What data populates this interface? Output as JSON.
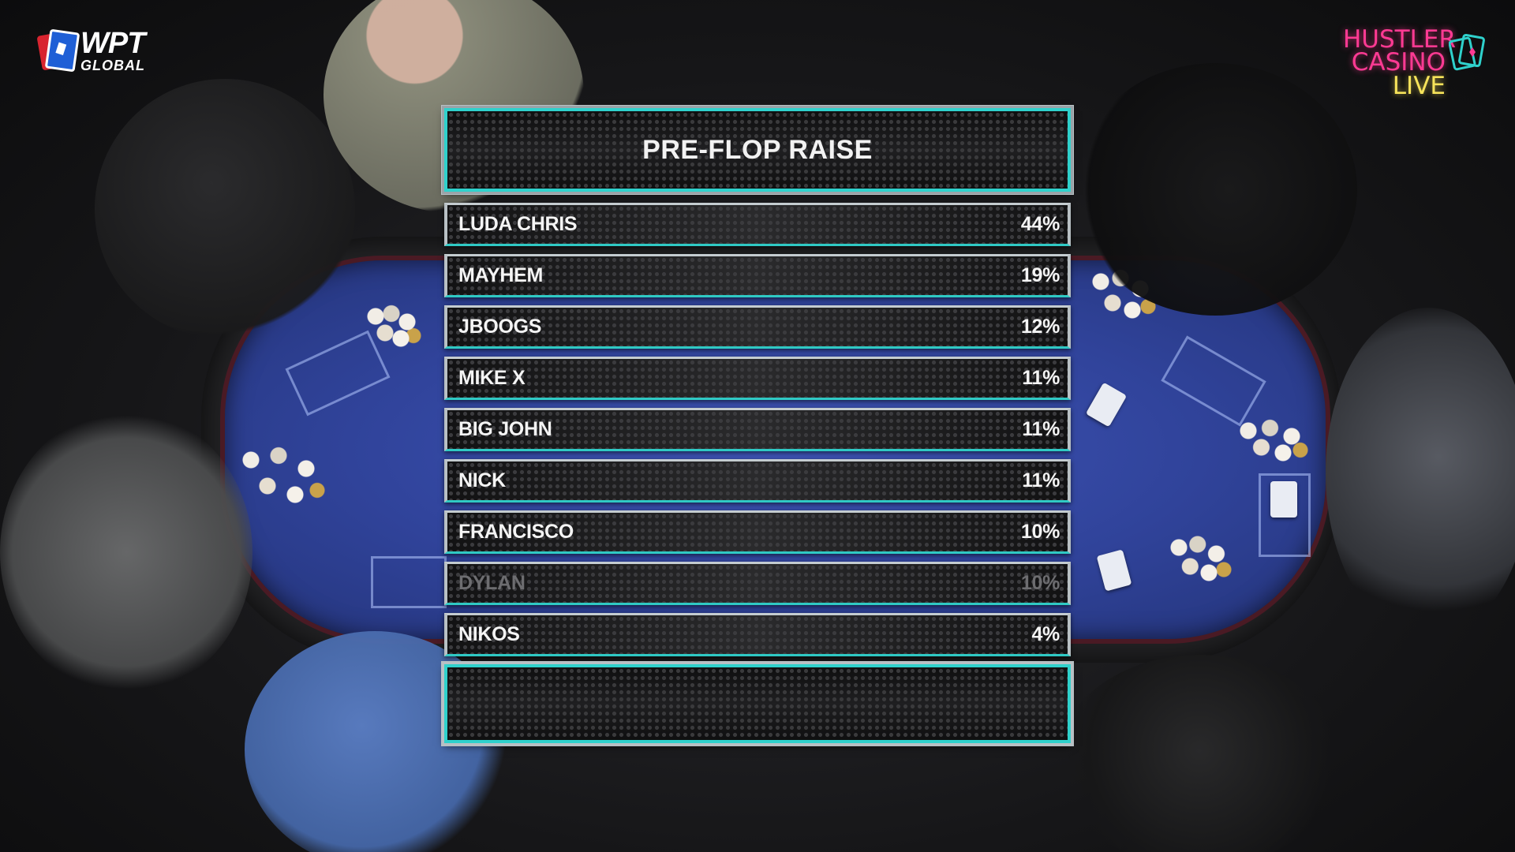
{
  "overlay": {
    "title": "PRE-FLOP RAISE",
    "rows": [
      {
        "name": "LUDA CHRIS",
        "percent": "44%",
        "dimmed": false
      },
      {
        "name": "MAYHEM",
        "percent": "19%",
        "dimmed": false
      },
      {
        "name": "JBOOGS",
        "percent": "12%",
        "dimmed": false
      },
      {
        "name": "MIKE X",
        "percent": "11%",
        "dimmed": false
      },
      {
        "name": "BIG JOHN",
        "percent": "11%",
        "dimmed": false
      },
      {
        "name": "NICK",
        "percent": "11%",
        "dimmed": false
      },
      {
        "name": "FRANCISCO",
        "percent": "10%",
        "dimmed": false
      },
      {
        "name": "DYLAN",
        "percent": "10%",
        "dimmed": true
      },
      {
        "name": "NIKOS",
        "percent": "4%",
        "dimmed": false
      }
    ]
  },
  "logos": {
    "wpt": {
      "word": "WPT",
      "sub": "GLOBAL",
      "icon": "wpt-cards-icon"
    },
    "hustler": {
      "line1": "HUSTLER",
      "line2": "CASINO",
      "line3": "LIVE",
      "icon": "cards-icon"
    }
  },
  "colors": {
    "accent_teal": "#2fd1cc",
    "frame_silver": "#b8c0c4",
    "dim_text": "#6d6d70",
    "felt_blue": "#3348a8",
    "hustler_pink": "#ff3a93",
    "hustler_yellow": "#f6e35a"
  }
}
